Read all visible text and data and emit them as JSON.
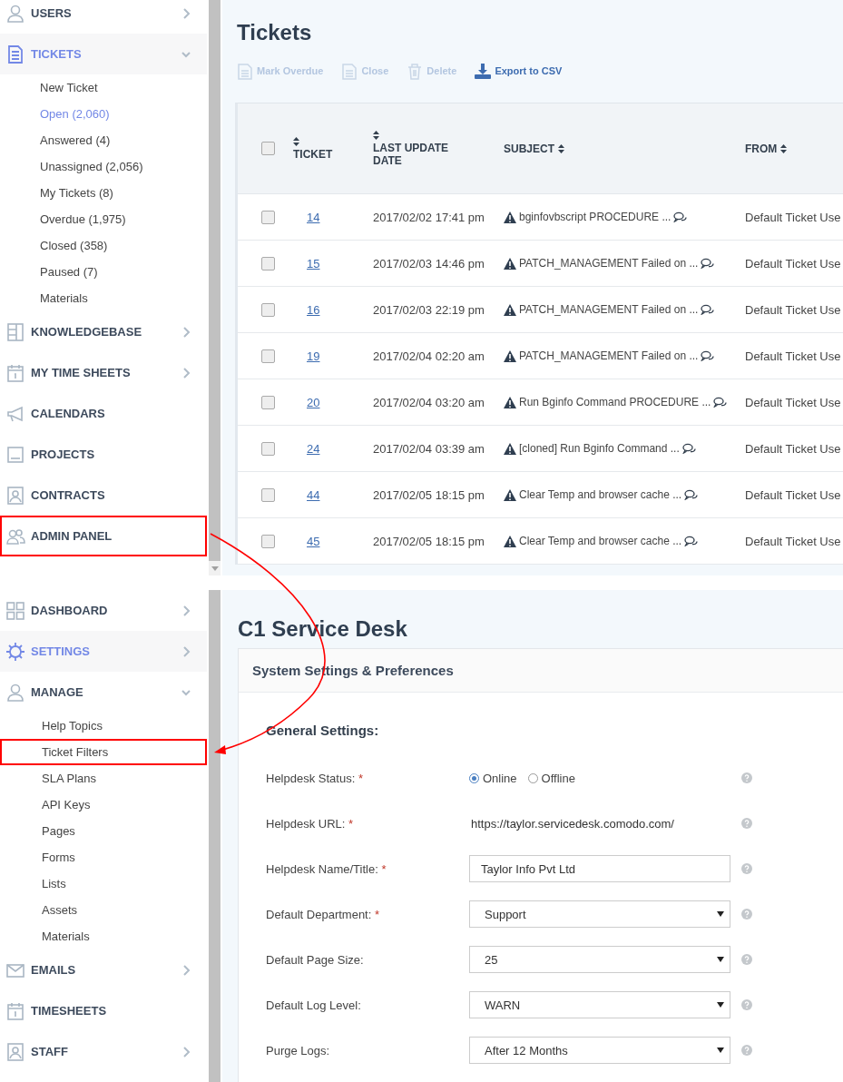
{
  "top_screen": {
    "sidebar": {
      "items": [
        {
          "label": "USERS",
          "selected": false,
          "expanded": false,
          "highlighted": false
        },
        {
          "label": "TICKETS",
          "selected": true,
          "expanded": true,
          "highlighted": false,
          "children": [
            {
              "label": "New Ticket",
              "selected": false
            },
            {
              "label": "Open (2,060)",
              "selected": true
            },
            {
              "label": "Answered (4)",
              "selected": false
            },
            {
              "label": "Unassigned (2,056)",
              "selected": false
            },
            {
              "label": "My Tickets (8)",
              "selected": false
            },
            {
              "label": "Overdue (1,975)",
              "selected": false
            },
            {
              "label": "Closed (358)",
              "selected": false
            },
            {
              "label": "Paused (7)",
              "selected": false
            },
            {
              "label": "Materials",
              "selected": false
            }
          ]
        },
        {
          "label": "KNOWLEDGEBASE",
          "selected": false,
          "expanded": false,
          "highlighted": false
        },
        {
          "label": "MY TIME SHEETS",
          "selected": false,
          "expanded": false,
          "highlighted": false
        },
        {
          "label": "CALENDARS",
          "selected": false,
          "highlighted": false
        },
        {
          "label": "PROJECTS",
          "selected": false,
          "highlighted": false
        },
        {
          "label": "CONTRACTS",
          "selected": false,
          "highlighted": false
        },
        {
          "label": "ADMIN PANEL",
          "selected": false,
          "highlighted": true
        }
      ]
    },
    "page": {
      "title": "Tickets",
      "toolbar": [
        {
          "label": "Mark Overdue",
          "disabled": true
        },
        {
          "label": "Close",
          "disabled": true
        },
        {
          "label": "Delete",
          "disabled": true
        },
        {
          "label": "Export to CSV",
          "disabled": false
        }
      ],
      "table": {
        "select_all_checked": false,
        "columns": [
          {
            "label": "TICKET",
            "sort_above": true
          },
          {
            "label": "LAST UPDATE DATE",
            "sort_above": true
          },
          {
            "label": "SUBJECT",
            "sort_above": false
          },
          {
            "label": "FROM",
            "sort_above": false
          }
        ],
        "rows": [
          {
            "checked": false,
            "ticket": "14",
            "date": "2017/02/02 17:41 pm",
            "subject": "bginfovbscript PROCEDURE ...",
            "from": "Default Ticket Use"
          },
          {
            "checked": false,
            "ticket": "15",
            "date": "2017/02/03 14:46 pm",
            "subject": "PATCH_MANAGEMENT Failed on ...",
            "from": "Default Ticket Use"
          },
          {
            "checked": false,
            "ticket": "16",
            "date": "2017/02/03 22:19 pm",
            "subject": "PATCH_MANAGEMENT Failed on ...",
            "from": "Default Ticket Use"
          },
          {
            "checked": false,
            "ticket": "19",
            "date": "2017/02/04 02:20 am",
            "subject": "PATCH_MANAGEMENT Failed on ...",
            "from": "Default Ticket Use"
          },
          {
            "checked": false,
            "ticket": "20",
            "date": "2017/02/04 03:20 am",
            "subject": "Run Bginfo Command PROCEDURE ...",
            "from": "Default Ticket Use"
          },
          {
            "checked": false,
            "ticket": "24",
            "date": "2017/02/04 03:39 am",
            "subject": "[cloned] Run Bginfo Command ...",
            "from": "Default Ticket Use"
          },
          {
            "checked": false,
            "ticket": "44",
            "date": "2017/02/05 18:15 pm",
            "subject": "Clear Temp and browser cache ...",
            "from": "Default Ticket Use"
          },
          {
            "checked": false,
            "ticket": "45",
            "date": "2017/02/05 18:15 pm",
            "subject": "Clear Temp and browser cache ...",
            "from": "Default Ticket Use"
          }
        ]
      }
    }
  },
  "bottom_screen": {
    "sidebar": {
      "items": [
        {
          "label": "DASHBOARD",
          "selected": false,
          "expanded": false,
          "highlighted": false
        },
        {
          "label": "SETTINGS",
          "selected": true,
          "expanded": false,
          "highlighted": false
        },
        {
          "label": "MANAGE",
          "selected": false,
          "expanded": true,
          "highlighted": false,
          "children": [
            {
              "label": "Help Topics",
              "selected": false,
              "highlighted": false
            },
            {
              "label": "Ticket Filters",
              "selected": false,
              "highlighted": true
            },
            {
              "label": "SLA Plans",
              "selected": false,
              "highlighted": false
            },
            {
              "label": "API Keys",
              "selected": false,
              "highlighted": false
            },
            {
              "label": "Pages",
              "selected": false,
              "highlighted": false
            },
            {
              "label": "Forms",
              "selected": false,
              "highlighted": false
            },
            {
              "label": "Lists",
              "selected": false,
              "highlighted": false
            },
            {
              "label": "Assets",
              "selected": false,
              "highlighted": false
            },
            {
              "label": "Materials",
              "selected": false,
              "highlighted": false
            }
          ]
        },
        {
          "label": "EMAILS",
          "selected": false,
          "expanded": false,
          "highlighted": false
        },
        {
          "label": "TIMESHEETS",
          "selected": false,
          "highlighted": false
        },
        {
          "label": "STAFF",
          "selected": false,
          "expanded": false,
          "highlighted": false
        }
      ]
    },
    "page": {
      "title": "C1 Service Desk",
      "card": {
        "title": "System Settings & Preferences",
        "section": "General Settings:",
        "fields": [
          {
            "label": "Helpdesk Status:",
            "required_mark": "*",
            "kind": "radio",
            "options": [
              {
                "label": "Online",
                "selected": true
              },
              {
                "label": "Offline",
                "selected": false
              }
            ]
          },
          {
            "label": "Helpdesk URL:",
            "required_mark": "*",
            "kind": "text",
            "value": "https://taylor.servicedesk.comodo.com/"
          },
          {
            "label": "Helpdesk Name/Title:",
            "required_mark": "*",
            "kind": "input",
            "value": "Taylor Info Pvt Ltd"
          },
          {
            "label": "Default Department:",
            "required_mark": "*",
            "kind": "select",
            "value": "Support"
          },
          {
            "label": "Default Page Size:",
            "kind": "select",
            "value": "25"
          },
          {
            "label": "Default Log Level:",
            "kind": "select",
            "value": "WARN"
          },
          {
            "label": "Purge Logs:",
            "kind": "select",
            "value": "After 12 Months"
          }
        ]
      }
    }
  }
}
